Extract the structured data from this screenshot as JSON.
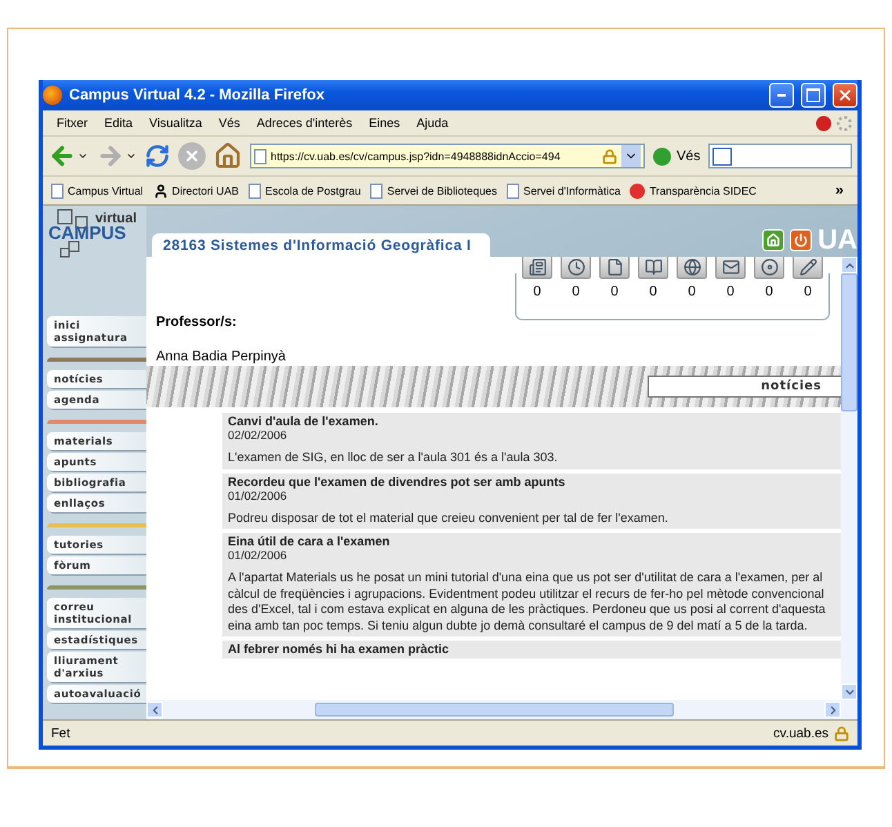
{
  "window": {
    "title": "Campus Virtual 4.2 - Mozilla Firefox"
  },
  "menu": [
    "Fitxer",
    "Edita",
    "Visualitza",
    "Vés",
    "Adreces d'interès",
    "Eines",
    "Ajuda"
  ],
  "toolbar": {
    "url": "https://cv.uab.es/cv/campus.jsp?idn=4948888idnAccio=494",
    "go": "Vés"
  },
  "bookmarks": [
    {
      "label": "Campus Virtual",
      "kind": "page"
    },
    {
      "label": "Directori UAB",
      "kind": "person"
    },
    {
      "label": "Escola de Postgrau",
      "kind": "page"
    },
    {
      "label": "Servei de Biblioteques",
      "kind": "page"
    },
    {
      "label": "Servei d'Informàtica",
      "kind": "page"
    },
    {
      "label": "Transparència SIDEC",
      "kind": "dots"
    }
  ],
  "bookmarks_more": "»",
  "site": {
    "logo_small": "virtual",
    "logo": "CAMPUS",
    "course_tab": "28163 Sistemes d'Informació Geogràfica I",
    "brand": "UA"
  },
  "sidebar": [
    {
      "items": [
        "inici assignatura"
      ]
    },
    {
      "color": "#8a7b60",
      "items": [
        "notícies",
        "agenda"
      ]
    },
    {
      "color": "#e08a6a",
      "items": [
        "materials",
        "apunts",
        "bibliografia",
        "enllaços"
      ]
    },
    {
      "color": "#e8c050",
      "items": [
        "tutories",
        "fòrum"
      ]
    },
    {
      "color": "#8e9660",
      "items": [
        "correu institucional",
        "estadístiques",
        "lliurament d'arxius",
        "autoavaluació"
      ]
    }
  ],
  "counters": [
    "0",
    "0",
    "0",
    "0",
    "0",
    "0",
    "0",
    "0"
  ],
  "professors": {
    "label": "Professor/s:",
    "names": [
      "Anna Badia Perpinyà"
    ]
  },
  "section_banner": "notícies",
  "news": [
    {
      "title": "Canvi d'aula de l'examen.",
      "date": "02/02/2006",
      "body": "L'examen de SIG, en lloc de ser a l'aula 301 és a l'aula 303."
    },
    {
      "title": "Recordeu que l'examen de divendres pot ser amb apunts",
      "date": "01/02/2006",
      "body": "Podreu disposar de tot el material que creieu convenient per tal de fer l'examen."
    },
    {
      "title": "Eina útil de cara a l'examen",
      "date": "01/02/2006",
      "body": "A l'apartat Materials us he posat un mini tutorial d'una eina que us pot ser d'utilitat de cara a l'examen, per al càlcul de freqüències i agrupacions. Evidentment podeu utilitzar el recurs de fer-ho pel mètode convencional des d'Excel, tal i com estava explicat en alguna de les pràctiques. Perdoneu que us posi al corrent d'aquesta eina amb tan poc temps. Si teniu algun dubte jo demà consultaré el campus de 9 del matí a 5 de la tarda."
    },
    {
      "title": "Al febrer només hi ha examen pràctic"
    }
  ],
  "status_bar": {
    "text": "Fet",
    "host": "cv.uab.es"
  }
}
